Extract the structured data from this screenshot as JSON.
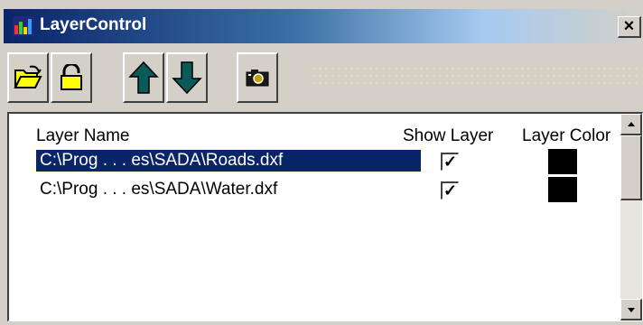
{
  "window": {
    "title": "LayerControl",
    "close_glyph": "×"
  },
  "toolbar": {
    "buttons": [
      {
        "name": "open-folder",
        "icon": "open-folder-icon"
      },
      {
        "name": "unlock",
        "icon": "padlock-icon"
      },
      {
        "name": "move-up",
        "icon": "arrow-up-icon"
      },
      {
        "name": "move-down",
        "icon": "arrow-down-icon"
      },
      {
        "name": "camera",
        "icon": "camera-icon"
      }
    ]
  },
  "table": {
    "columns": {
      "name": "Layer Name",
      "show": "Show Layer",
      "color": "Layer Color"
    },
    "rows": [
      {
        "name": "C:\\Prog . . . es\\SADA\\Roads.dxf",
        "show": true,
        "show_glyph": "✓",
        "color": "#000000",
        "selected": true
      },
      {
        "name": "C:\\Prog . . . es\\SADA\\Water.dxf",
        "show": true,
        "show_glyph": "✓",
        "color": "#000000",
        "selected": false
      }
    ]
  },
  "colors": {
    "title_bar_start": "#0a246a",
    "selection": "#0a246a",
    "arrow_icon": "#0a5a5a",
    "folder_icon": "#ffff00"
  }
}
